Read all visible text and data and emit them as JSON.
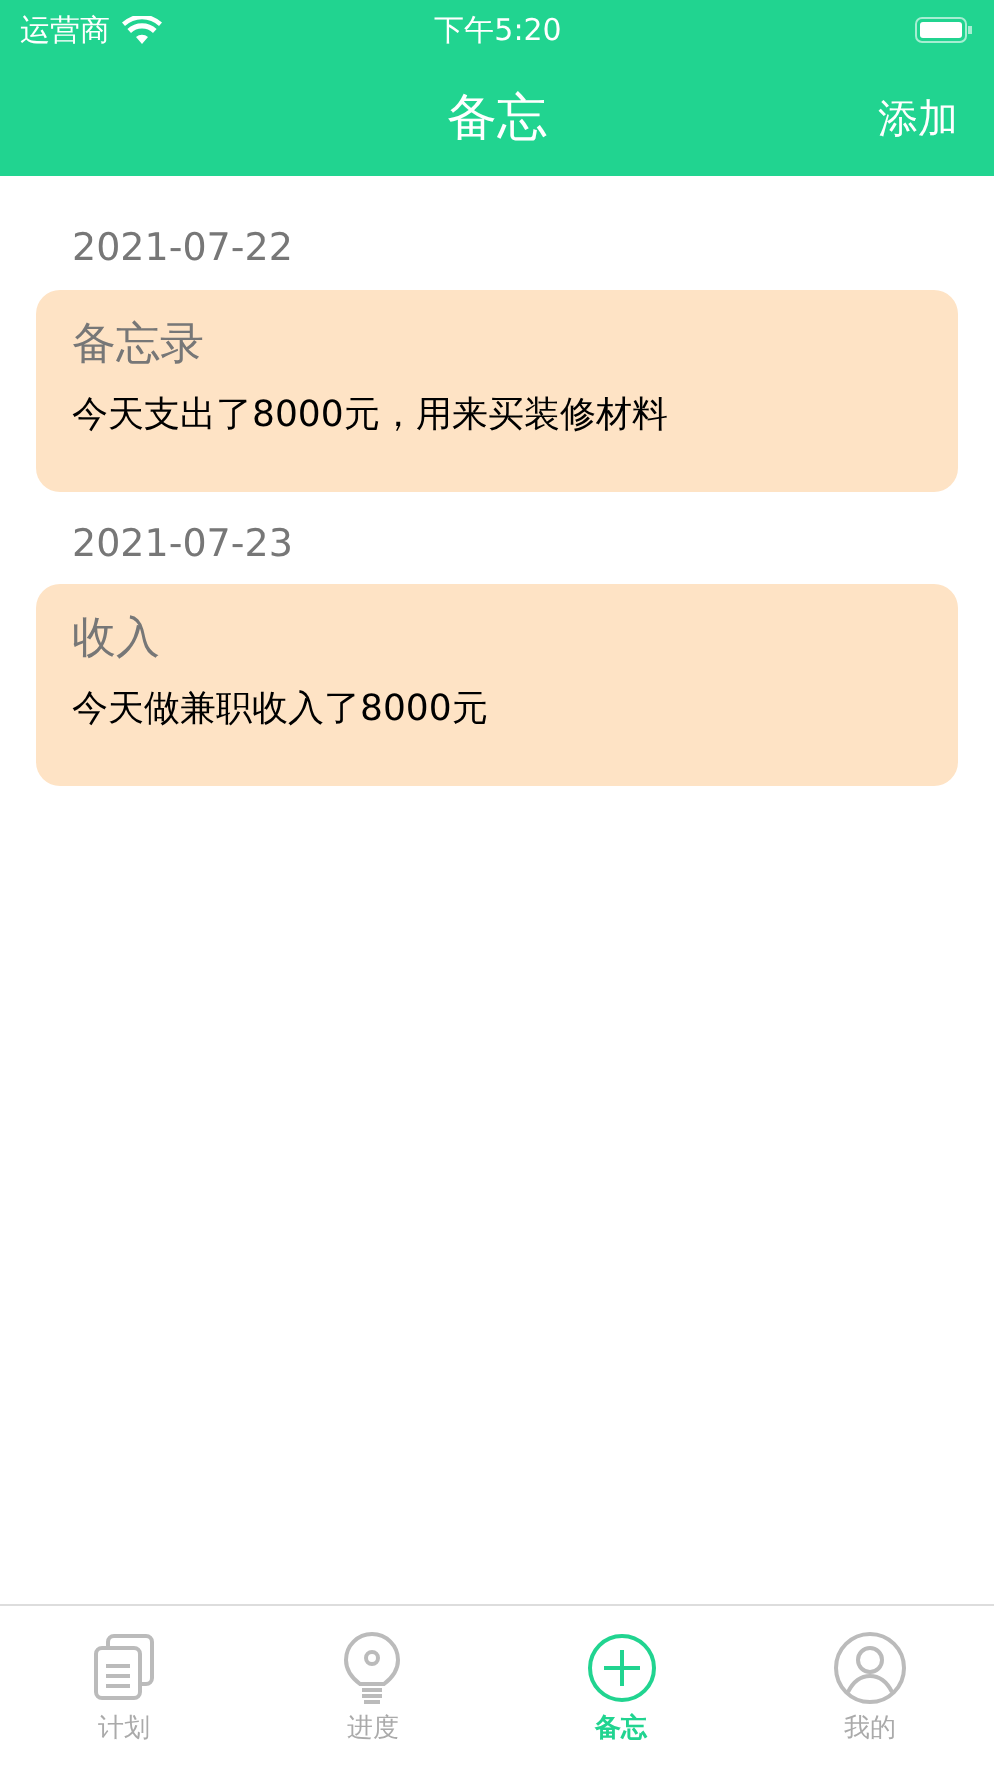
{
  "status_bar": {
    "carrier": "运营商",
    "time": "下午5:20"
  },
  "nav": {
    "title": "备忘",
    "action": "添加"
  },
  "memos": [
    {
      "date": "2021-07-22",
      "title": "备忘录",
      "body": "今天支出了8000元，用来买装修材料"
    },
    {
      "date": "2021-07-23",
      "title": "收入",
      "body": "今天做兼职收入了8000元"
    }
  ],
  "tabs": [
    {
      "kind": "plan",
      "label": "计划",
      "selected": false
    },
    {
      "kind": "progress",
      "label": "进度",
      "selected": false
    },
    {
      "kind": "memo",
      "label": "备忘",
      "selected": true
    },
    {
      "kind": "mine",
      "label": "我的",
      "selected": false
    }
  ]
}
